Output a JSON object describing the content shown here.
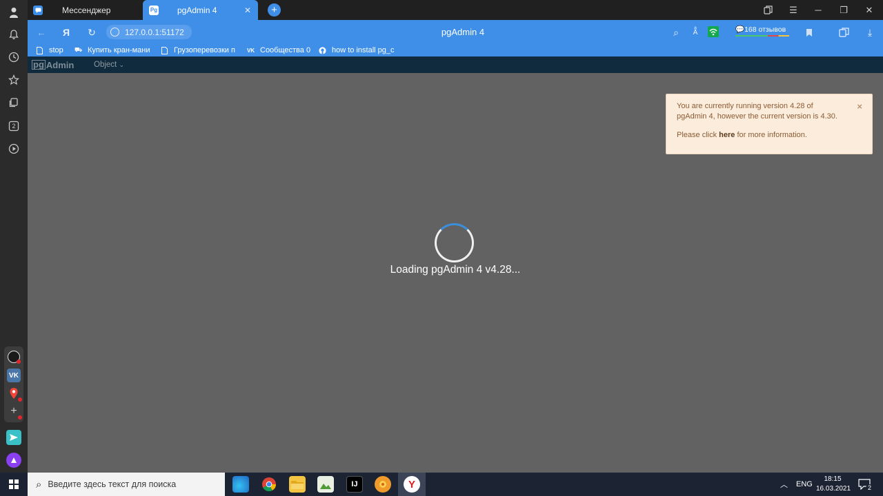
{
  "tabs": [
    {
      "label": "Мессенджер"
    },
    {
      "label": "pgAdmin 4",
      "active": true
    }
  ],
  "address": {
    "url": "127.0.0.1:51172",
    "page_title": "pgAdmin 4",
    "reviews": "168 отзывов"
  },
  "bookmarks": [
    {
      "label": "stop"
    },
    {
      "label": "Купить кран-мани"
    },
    {
      "label": "Грузоперевозки п"
    },
    {
      "label": "Сообщества 0"
    },
    {
      "label": "how to install pg_c"
    }
  ],
  "pgadmin": {
    "logo_pg": "pg",
    "logo_admin": "Admin",
    "object_menu": "Object"
  },
  "alert": {
    "line1": "You are currently running version 4.28 of pgAdmin 4, however the current version is 4.30.",
    "line2_before": "Please click ",
    "line2_link": "here",
    "line2_after": " for more information.",
    "close": "×"
  },
  "loading_text": "Loading pgAdmin 4 v4.28...",
  "taskbar": {
    "search_placeholder": "Введите здесь текст для поиска",
    "language": "ENG",
    "time": "18:15",
    "date": "16.03.2021",
    "notifications": "2"
  },
  "sidebar": {
    "counter": "2"
  },
  "colors": {
    "accent": "#3f8fe8",
    "content_bg": "#626262",
    "pgadmin_nav": "#102b3d",
    "alert_bg": "#fcecdc",
    "spinner": "#3d8eda"
  }
}
